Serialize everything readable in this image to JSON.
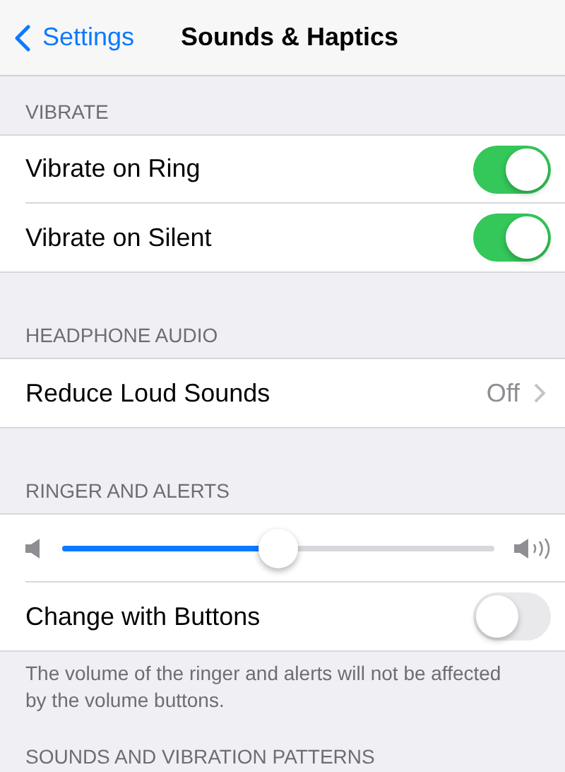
{
  "nav": {
    "back": "Settings",
    "title": "Sounds & Haptics"
  },
  "sections": [
    {
      "header": "VIBRATE",
      "rows": [
        {
          "kind": "toggle",
          "label": "Vibrate on Ring",
          "on": true
        },
        {
          "kind": "toggle",
          "label": "Vibrate on Silent",
          "on": true
        }
      ]
    },
    {
      "header": "HEADPHONE AUDIO",
      "rows": [
        {
          "kind": "disclosure",
          "label": "Reduce Loud Sounds",
          "value": "Off"
        }
      ]
    },
    {
      "header": "RINGER AND ALERTS",
      "rows": [
        {
          "kind": "slider",
          "level": 0.5
        },
        {
          "kind": "toggle",
          "label": "Change with Buttons",
          "on": false
        }
      ],
      "footer": "The volume of the ringer and alerts will not be affected by the volume buttons."
    },
    {
      "header": "SOUNDS AND VIBRATION PATTERNS"
    }
  ]
}
